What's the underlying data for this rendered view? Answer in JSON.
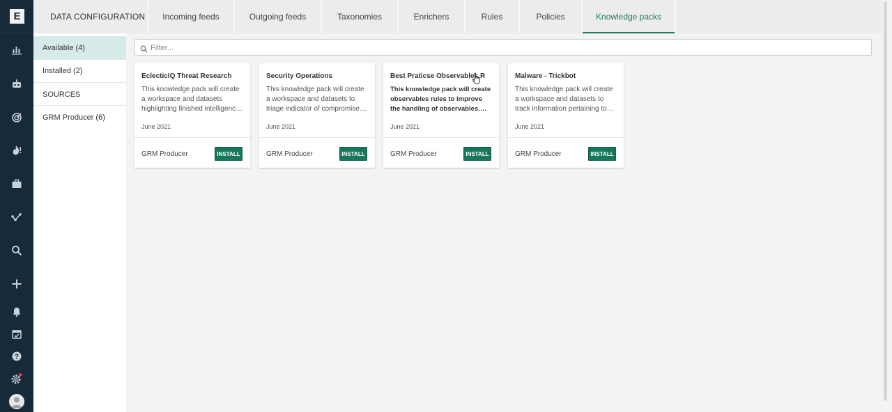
{
  "app": {
    "logo_letter": "E"
  },
  "rail": {
    "icons": [
      "bar-chart-icon",
      "robot-icon",
      "radar-icon",
      "fire-icon",
      "briefcase-icon",
      "graph-icon",
      "search-icon",
      "plus-icon",
      "bell-icon",
      "calendar-check-icon",
      "help-icon",
      "settings-icon",
      "user-avatar-icon"
    ]
  },
  "tabs": {
    "section_title": "DATA CONFIGURATION",
    "items": [
      {
        "label": "Incoming feeds"
      },
      {
        "label": "Outgoing feeds"
      },
      {
        "label": "Taxonomies"
      },
      {
        "label": "Enrichers"
      },
      {
        "label": "Rules"
      },
      {
        "label": "Policies"
      },
      {
        "label": "Knowledge packs"
      }
    ],
    "active": "Knowledge packs"
  },
  "sidebar": {
    "items": [
      {
        "label": "Available (4)"
      },
      {
        "label": "Installed (2)"
      }
    ],
    "sources_heading": "SOURCES",
    "sources": [
      {
        "label": "GRM Producer (6)"
      }
    ]
  },
  "filter": {
    "placeholder": "Filter...",
    "value": ""
  },
  "cards": [
    {
      "title": "EclecticIQ Threat Research",
      "description": "This knowledge pack will create a workspace and datasets highlighting finished intelligenc…",
      "date": "June 2021",
      "producer": "GRM Producer",
      "button": "INSTALL"
    },
    {
      "title": "Security Operations",
      "description": "This knowledge pack will create a workspace and datasets to triage indicator of compromise…",
      "date": "June 2021",
      "producer": "GRM Producer",
      "button": "INSTALL"
    },
    {
      "title": "Best Praticse Observables R",
      "description": "This knowledge pack will create observables rules to improve the handling of observables. The…",
      "date": "June 2021",
      "producer": "GRM Producer",
      "button": "INSTALL"
    },
    {
      "title": "Malware - Trickbot",
      "description": "This knowledge pack will create a workspace and datasets to track information pertaining to…",
      "date": "June 2021",
      "producer": "GRM Producer",
      "button": "INSTALL"
    }
  ],
  "colors": {
    "rail": "#172a3a",
    "accent": "#1f7a5c",
    "install_button": "#17775b",
    "selected_nav": "#d6ebe9",
    "notification_dot": "#e0463c"
  }
}
